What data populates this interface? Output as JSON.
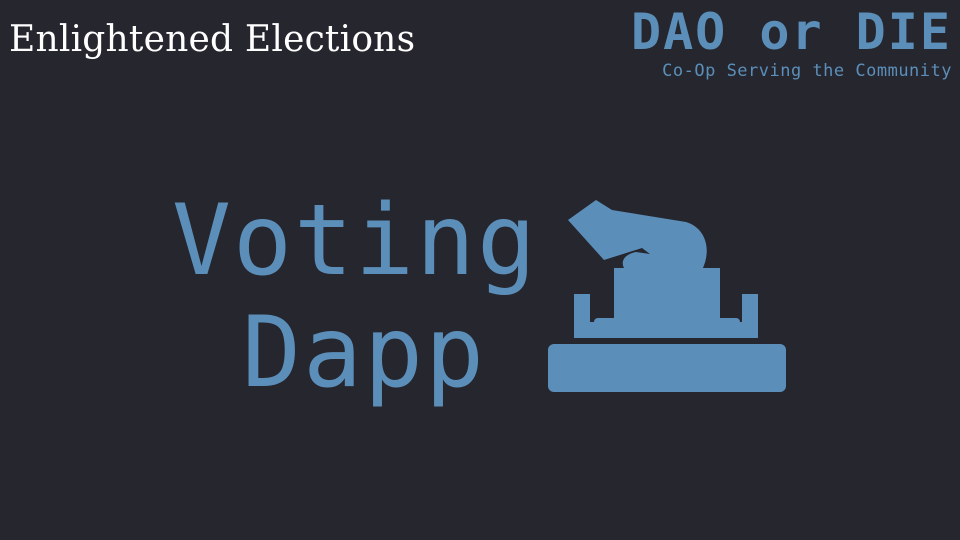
{
  "slide": {
    "title": "Enlightened Elections"
  },
  "brand": {
    "name": "DAO or DIE",
    "tagline": "Co-Op Serving the Community"
  },
  "hero": {
    "line1": "Voting",
    "line2": "Dapp",
    "icon": "ballot-box-icon"
  },
  "colors": {
    "background": "#26262f",
    "accent": "#5b8fb9",
    "title_text": "#ffffff"
  }
}
